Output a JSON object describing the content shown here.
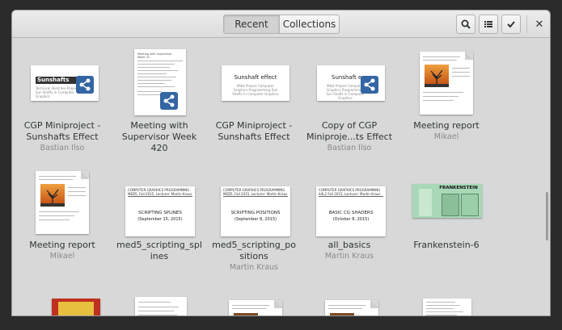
{
  "header": {
    "tabs": [
      {
        "label": "Recent"
      },
      {
        "label": "Collections"
      }
    ],
    "buttons": {
      "search": "search-icon",
      "view": "list-icon",
      "select": "check-icon",
      "close": "✕"
    }
  },
  "row1": [
    {
      "title1": "CGP Miniproject -",
      "title2": "Sunshafts Effect",
      "sub": "Bastian Ilso",
      "thumb_title": "Sunshafts Eff",
      "thumb_lines": "Technical Sketches Project Sun Shafts in Computer Graphics"
    },
    {
      "title1": "Meeting with",
      "title2": "Supervisor Week",
      "title3": "420",
      "sub": "",
      "thumb_title": "Meeting with Supervisor Week 41"
    },
    {
      "title1": "CGP Miniproject -",
      "title2": "Sunshafts Effect",
      "sub": "",
      "thumb_title": "Sunshaft effect",
      "thumb_lines": "Mikit Project Computer Graphics Programming Sun Shafts in Computer Graphics"
    },
    {
      "title1": "Copy of CGP",
      "title2": "Miniproje...ts Effect",
      "sub": "Bastian Ilso",
      "thumb_title": "Sunshaft e",
      "thumb_lines": "Mikit Project Computer Graphics Programming Sun Shafts in Computer Graphics"
    },
    {
      "title1": "Meeting report",
      "sub": "Mikael"
    }
  ],
  "row2": [
    {
      "title1": "Meeting report",
      "sub": "Mikael"
    },
    {
      "title1": "med5_scripting_spl",
      "title2": "ines",
      "sub": "",
      "thumb_head": "COMPUTER GRAPHICS PROGRAMMING MED5, Fall 2015, Lecturer: Martin Kraus",
      "thumb_title": "SCRIPTING SPLINES",
      "thumb_date": "(September 15, 2015)"
    },
    {
      "title1": "med5_scripting_po",
      "title2": "sitions",
      "sub": "Martin Kraus",
      "thumb_head": "COMPUTER GRAPHICS PROGRAMMING MED5, Fall 2015, Lecturer: Martin Kraus",
      "thumb_title": "SCRIPTING POSITIONS",
      "thumb_date": "(September 8, 2015)"
    },
    {
      "title1": "all_basics",
      "sub": "Martin Kraus",
      "thumb_head": "COMPUTER GRAPHICS PROGRAMMING A4L2 Fall 2015, Lecturer: Martin Kraus",
      "thumb_title": "BASIC CG SHADERS",
      "thumb_date": "(October 8, 2015)"
    },
    {
      "title1": "Frankenstein-6",
      "sub": "",
      "thumb_title": "FRANKENSTEIN"
    }
  ],
  "colors": {
    "accent": "#3465a4",
    "background": "#d8d8d8"
  }
}
